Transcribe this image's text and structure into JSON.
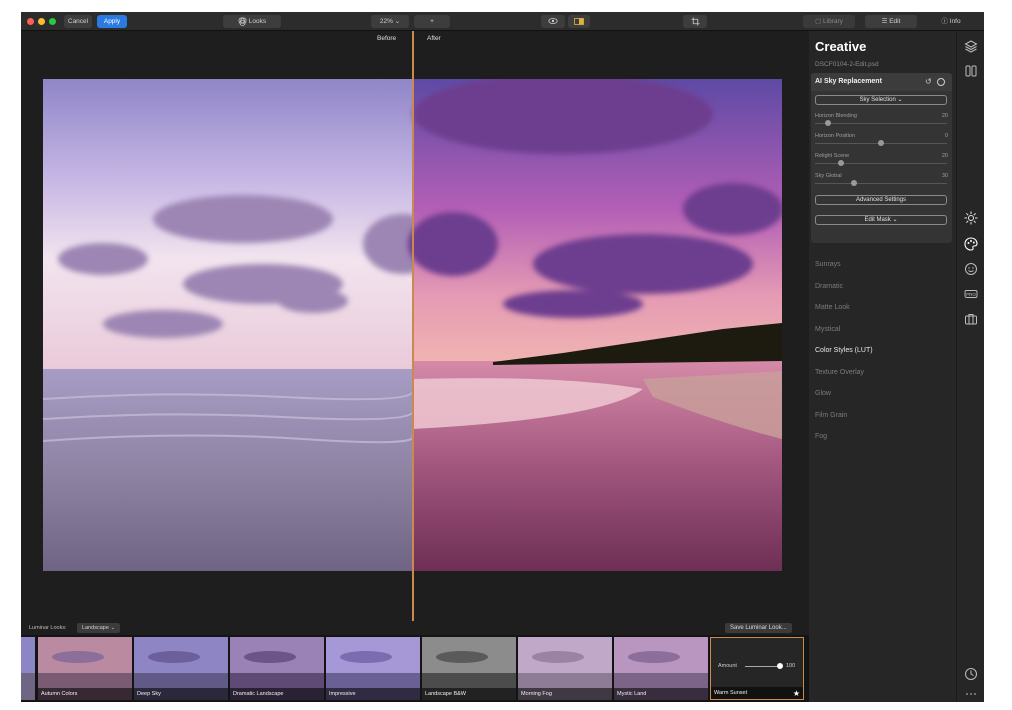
{
  "toolbar": {
    "cancel": "Cancel",
    "apply": "Apply",
    "looks": "Looks",
    "zoom": "22%",
    "zoom_step": "+",
    "library": "Library",
    "edit": "Edit",
    "info": "Info"
  },
  "canvas": {
    "before_label": "Before",
    "after_label": "After"
  },
  "panel": {
    "title": "Creative",
    "file_name": "DSCF0104-2-Edit.psd",
    "sky": {
      "title": "AI Sky Replacement",
      "undo_icon": "undo-icon",
      "sky_selection": "Sky Selection",
      "sliders": [
        {
          "label": "Horizon Blending",
          "value": "20",
          "level": 0.1
        },
        {
          "label": "Horizon Position",
          "value": "0",
          "level": 0.5
        },
        {
          "label": "Relight Scene",
          "value": "20",
          "level": 0.2
        },
        {
          "label": "Sky Global",
          "value": "30",
          "level": 0.3
        }
      ],
      "advanced_settings": "Advanced Settings",
      "edit_mask": "Edit Mask"
    },
    "filters": [
      {
        "label": "Sunrays",
        "bright": false
      },
      {
        "label": "Dramatic",
        "bright": false
      },
      {
        "label": "Matte Look",
        "bright": false
      },
      {
        "label": "Mystical",
        "bright": false
      },
      {
        "label": "Color Styles (LUT)",
        "bright": true
      },
      {
        "label": "Texture Overlay",
        "bright": false
      },
      {
        "label": "Glow",
        "bright": false
      },
      {
        "label": "Film Grain",
        "bright": false
      },
      {
        "label": "Fog",
        "bright": false
      }
    ]
  },
  "looks": {
    "label": "Luminar Looks:",
    "category": "Landscape",
    "save": "Save Luminar Look...",
    "items": [
      {
        "name": "Autumn Colors",
        "tint": "#b98aa0"
      },
      {
        "name": "Deep Sky",
        "tint": "#8e86c4"
      },
      {
        "name": "Dramatic Landscape",
        "tint": "#9a82b6"
      },
      {
        "name": "Impressive",
        "tint": "#a697d6"
      },
      {
        "name": "Landscape B&W",
        "tint": "#8c8c8c"
      },
      {
        "name": "Morning Fog",
        "tint": "#c0a8c8"
      },
      {
        "name": "Mystic Land",
        "tint": "#b896c0"
      },
      {
        "name": "Warm Sunset",
        "tint": "#262626"
      }
    ],
    "amount_label": "Amount",
    "amount_value": "100",
    "amount_level": 1.0
  },
  "colors": {
    "accent": "#2a7ae2",
    "divider": "#c98a4b",
    "panel": "#262626"
  }
}
